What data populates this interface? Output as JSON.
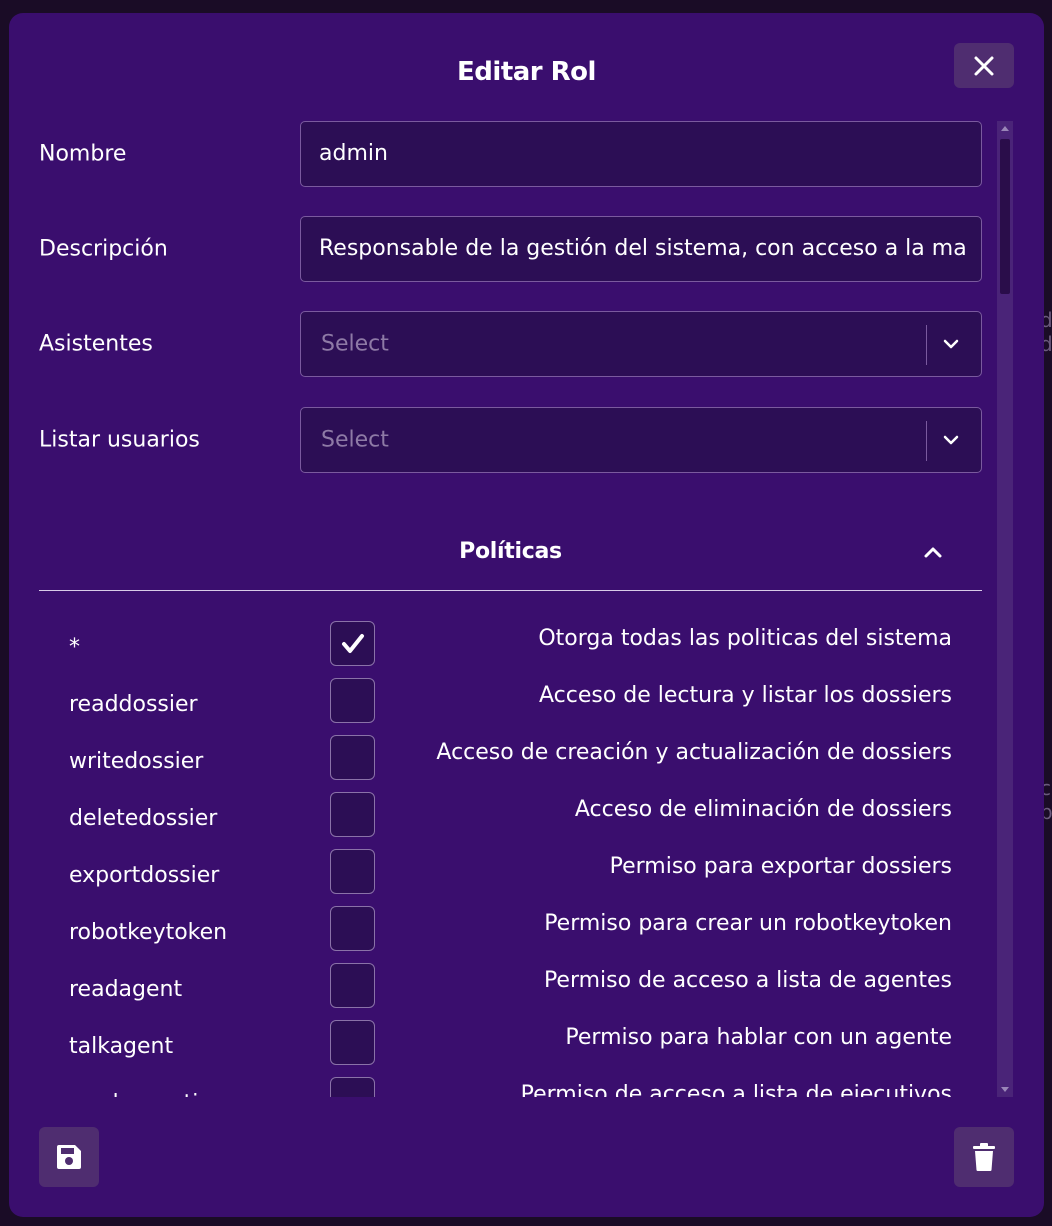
{
  "modal": {
    "title": "Editar Rol",
    "close_icon": "close-icon",
    "save_icon": "floppy-disk-icon",
    "delete_icon": "trash-icon"
  },
  "form": {
    "nombre": {
      "label": "Nombre",
      "value": "admin"
    },
    "descripcion": {
      "label": "Descripción",
      "value": "Responsable de la gestión del sistema, con acceso a la ma"
    },
    "asistentes": {
      "label": "Asistentes",
      "placeholder": "Select"
    },
    "listar_usuarios": {
      "label": "Listar usuarios",
      "placeholder": "Select"
    }
  },
  "policies": {
    "title": "Políticas",
    "items": [
      {
        "key": "*",
        "checked": true,
        "description": "Otorga todas las politicas del sistema"
      },
      {
        "key": "readdossier",
        "checked": false,
        "description": "Acceso de lectura y listar los dossiers"
      },
      {
        "key": "writedossier",
        "checked": false,
        "description": "Acceso de creación y actualización de dossiers"
      },
      {
        "key": "deletedossier",
        "checked": false,
        "description": "Acceso de eliminación de dossiers"
      },
      {
        "key": "exportdossier",
        "checked": false,
        "description": "Permiso para exportar dossiers"
      },
      {
        "key": "robotkeytoken",
        "checked": false,
        "description": "Permiso para crear un robotkeytoken"
      },
      {
        "key": "readagent",
        "checked": false,
        "description": "Permiso de acceso a lista de agentes"
      },
      {
        "key": "talkagent",
        "checked": false,
        "description": "Permiso para hablar con un agente"
      },
      {
        "key": "readexecutive",
        "checked": false,
        "description": "Permiso de acceso a lista de ejecutivos"
      }
    ]
  },
  "colors": {
    "modal_bg": "#3a0e6e",
    "input_bg": "#2c0e55",
    "button_bg": "#4f2d70"
  }
}
